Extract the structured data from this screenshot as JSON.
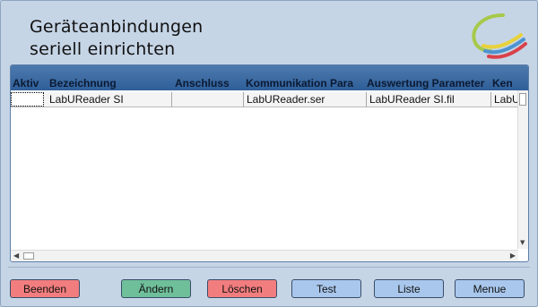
{
  "window": {
    "title_line1": "Geräteanbindungen",
    "title_line2": "seriell einrichten"
  },
  "grid": {
    "columns": [
      "Aktiv",
      "Bezeichnung",
      "Anschluss",
      "Kommunikation Para",
      "Auswertung Parameter",
      "Ken"
    ],
    "rows": [
      {
        "aktiv": "",
        "bezeichnung": "LabUReader SI",
        "anschluss": "",
        "kommunikation": "LabUReader.ser",
        "auswertung": "LabUReader SI.fil",
        "ken": "LabU"
      }
    ]
  },
  "buttons": {
    "beenden": "Beenden",
    "aendern": "Ändern",
    "loeschen": "Löschen",
    "test": "Test",
    "liste": "Liste",
    "menue": "Menue"
  },
  "colors": {
    "background": "#c6d5e6",
    "grid_header": "#3a6aa3",
    "button_red": "#f27d7e",
    "button_green": "#6fbf9a",
    "button_blue": "#a9c7ec"
  },
  "icons": {
    "logo": "colored-swoosh-logo"
  }
}
